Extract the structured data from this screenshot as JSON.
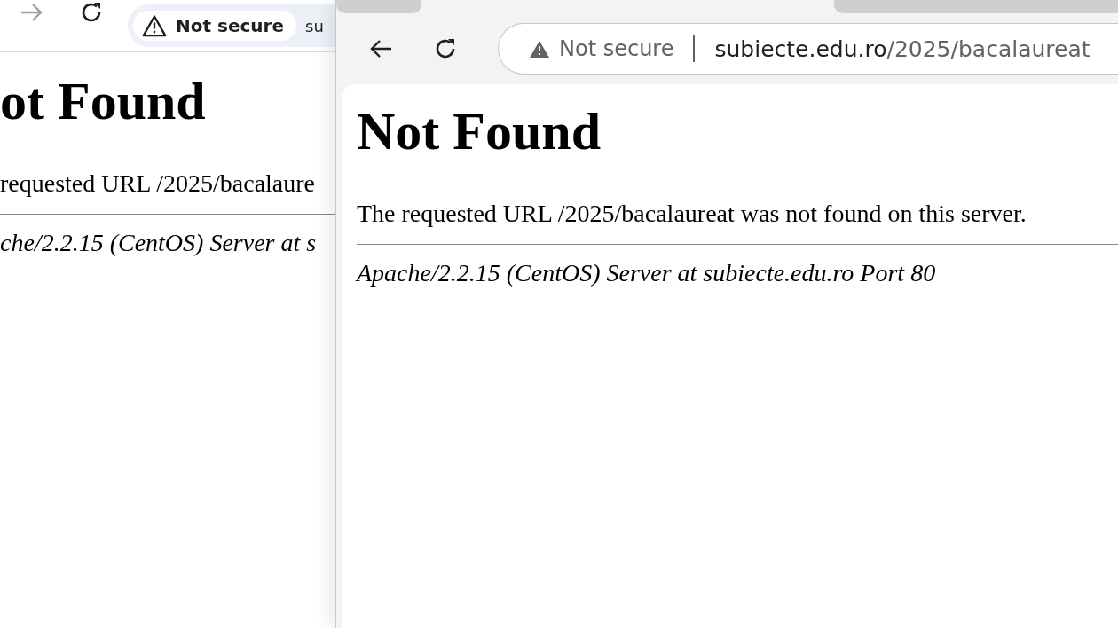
{
  "windows": [
    {
      "nav_buttons": [
        {
          "kind": "forward",
          "disabled": true
        },
        {
          "kind": "reload",
          "disabled": false
        }
      ],
      "address": {
        "security_chip": true,
        "security": "Not secure",
        "url_host": "su"
      },
      "page": {
        "heading": "ot Found",
        "message": "requested URL /2025/bacalaure",
        "footer": "che/2.2.15 (CentOS) Server at s"
      }
    },
    {
      "nav_buttons": [
        {
          "kind": "back",
          "disabled": false
        },
        {
          "kind": "reload",
          "disabled": false
        }
      ],
      "address": {
        "security_chip": false,
        "security": "Not secure",
        "url_host": "subiecte.edu.ro",
        "url_path": "/2025/bacalaureat"
      },
      "page": {
        "heading": "Not Found",
        "message": "The requested URL /2025/bacalaureat was not found on this server.",
        "footer": "Apache/2.2.15 (CentOS) Server at subiecte.edu.ro Port 80"
      }
    }
  ]
}
